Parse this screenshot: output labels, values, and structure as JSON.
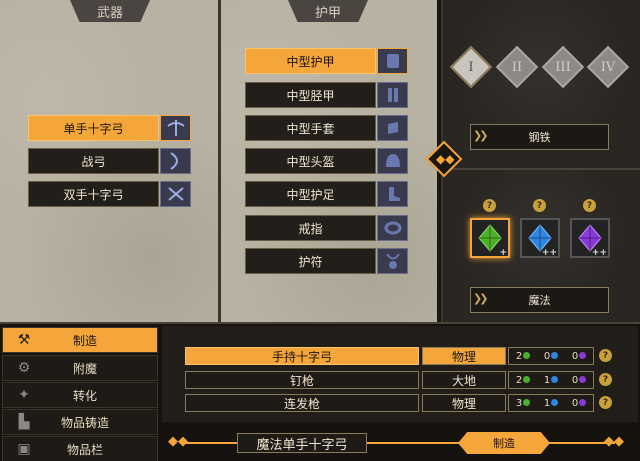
{
  "weapons": {
    "title": "武器",
    "items": [
      {
        "label": "单手十字弓",
        "selected": true
      },
      {
        "label": "战弓",
        "selected": false
      },
      {
        "label": "双手十字弓",
        "selected": false
      }
    ]
  },
  "armor": {
    "title": "护甲",
    "items": [
      {
        "label": "中型护甲",
        "selected": true
      },
      {
        "label": "中型胫甲",
        "selected": false
      },
      {
        "label": "中型手套",
        "selected": false
      },
      {
        "label": "中型头盔",
        "selected": false
      },
      {
        "label": "中型护足",
        "selected": false
      },
      {
        "label": "戒指",
        "selected": false
      },
      {
        "label": "护符",
        "selected": false
      }
    ]
  },
  "tiers": [
    {
      "label": "I",
      "selected": true
    },
    {
      "label": "II",
      "selected": false
    },
    {
      "label": "III",
      "selected": false
    },
    {
      "label": "IV",
      "selected": false
    }
  ],
  "material": {
    "label": "钢铁"
  },
  "enchant": {
    "label": "魔法",
    "gems": [
      {
        "color": "#4caf2a",
        "plus": "+",
        "selected": true,
        "help": "?"
      },
      {
        "color": "#2f86e0",
        "plus": "++",
        "selected": false,
        "help": "?"
      },
      {
        "color": "#8a3ad8",
        "plus": "++",
        "selected": false,
        "help": "?"
      }
    ]
  },
  "sidebar": {
    "items": [
      {
        "label": "制造",
        "icon": "hammer-wrench-icon",
        "selected": true
      },
      {
        "label": "附魔",
        "icon": "enchant-gear-icon",
        "selected": false
      },
      {
        "label": "转化",
        "icon": "transform-icon",
        "selected": false
      },
      {
        "label": "物品铸造",
        "icon": "anvil-icon",
        "selected": false
      },
      {
        "label": "物品栏",
        "icon": "backpack-icon",
        "selected": false
      }
    ]
  },
  "recipes": [
    {
      "name": "手持十字弓",
      "type": "物理",
      "cost": [
        "2",
        "0",
        "0"
      ],
      "selected": true
    },
    {
      "name": "钉枪",
      "type": "大地",
      "cost": [
        "2",
        "1",
        "0"
      ],
      "selected": false
    },
    {
      "name": "连发枪",
      "type": "物理",
      "cost": [
        "3",
        "1",
        "0"
      ],
      "selected": false
    }
  ],
  "footer": {
    "item_name": "魔法单手十字弓",
    "craft_label": "制造"
  }
}
